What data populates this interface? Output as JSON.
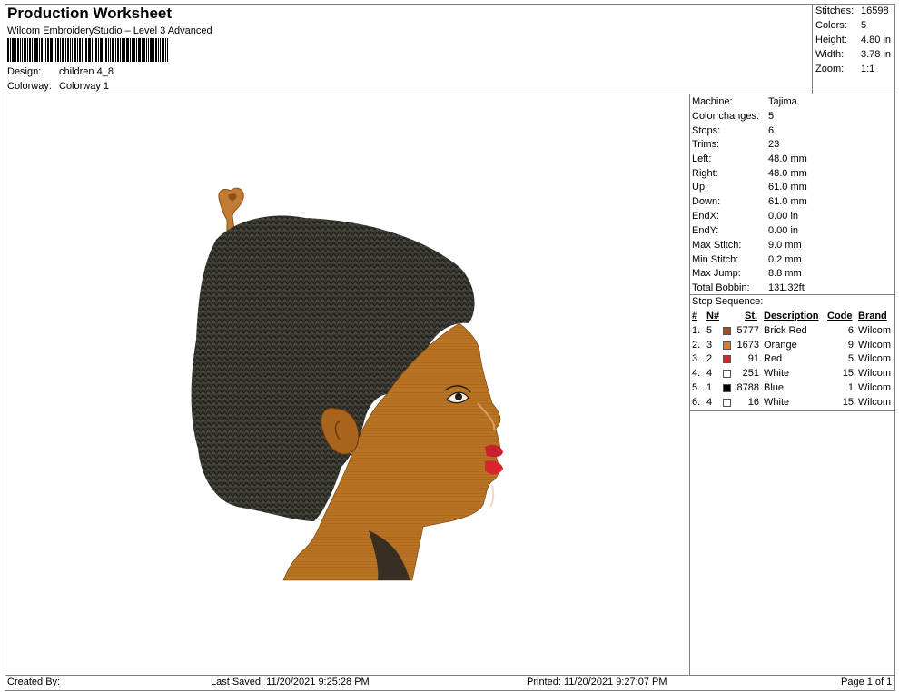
{
  "header": {
    "title": "Production Worksheet",
    "subtitle": "Wilcom EmbroideryStudio – Level 3 Advanced",
    "design_label": "Design:",
    "design_value": "children 4_8",
    "colorway_label": "Colorway:",
    "colorway_value": "Colorway 1"
  },
  "summary": {
    "stitches_label": "Stitches:",
    "stitches_value": "16598",
    "colors_label": "Colors:",
    "colors_value": "5",
    "height_label": "Height:",
    "height_value": "4.80 in",
    "width_label": "Width:",
    "width_value": "3.78 in",
    "zoom_label": "Zoom:",
    "zoom_value": "1:1"
  },
  "machine_info": [
    {
      "label": "Machine:",
      "value": "Tajima"
    },
    {
      "label": "Color changes:",
      "value": "5"
    },
    {
      "label": "Stops:",
      "value": "6"
    },
    {
      "label": "Trims:",
      "value": "23"
    },
    {
      "label": "Left:",
      "value": "48.0 mm"
    },
    {
      "label": "Right:",
      "value": "48.0 mm"
    },
    {
      "label": "Up:",
      "value": "61.0 mm"
    },
    {
      "label": "Down:",
      "value": "61.0 mm"
    },
    {
      "label": "EndX:",
      "value": "0.00 in"
    },
    {
      "label": "EndY:",
      "value": "0.00 in"
    },
    {
      "label": "Max Stitch:",
      "value": "9.0 mm"
    },
    {
      "label": "Min Stitch:",
      "value": "0.2 mm"
    },
    {
      "label": "Max Jump:",
      "value": "8.8 mm"
    },
    {
      "label": "Total Bobbin:",
      "value": "131.32ft"
    }
  ],
  "stop_sequence": {
    "title": "Stop Sequence:",
    "headers": {
      "num": "#",
      "n": "N#",
      "st": "St.",
      "description": "Description",
      "code": "Code",
      "brand": "Brand"
    },
    "rows": [
      {
        "num": "1.",
        "n": "5",
        "color": "#9b4f1c",
        "st": "5777",
        "description": "Brick Red",
        "code": "6",
        "brand": "Wilcom"
      },
      {
        "num": "2.",
        "n": "3",
        "color": "#e07a1e",
        "st": "1673",
        "description": "Orange",
        "code": "9",
        "brand": "Wilcom"
      },
      {
        "num": "3.",
        "n": "2",
        "color": "#d9232d",
        "st": "91",
        "description": "Red",
        "code": "5",
        "brand": "Wilcom"
      },
      {
        "num": "4.",
        "n": "4",
        "color": "#ffffff",
        "st": "251",
        "description": "White",
        "code": "15",
        "brand": "Wilcom"
      },
      {
        "num": "5.",
        "n": "1",
        "color": "#000000",
        "st": "8788",
        "description": "Blue",
        "code": "1",
        "brand": "Wilcom"
      },
      {
        "num": "6.",
        "n": "4",
        "color": "#ffffff",
        "st": "16",
        "description": "White",
        "code": "15",
        "brand": "Wilcom"
      }
    ]
  },
  "footer": {
    "created_by": "Created By:",
    "last_saved": "Last Saved: 11/20/2021 9:25:28 PM",
    "printed": "Printed: 11/20/2021 9:27:07 PM",
    "page": "Page 1 of 1"
  }
}
